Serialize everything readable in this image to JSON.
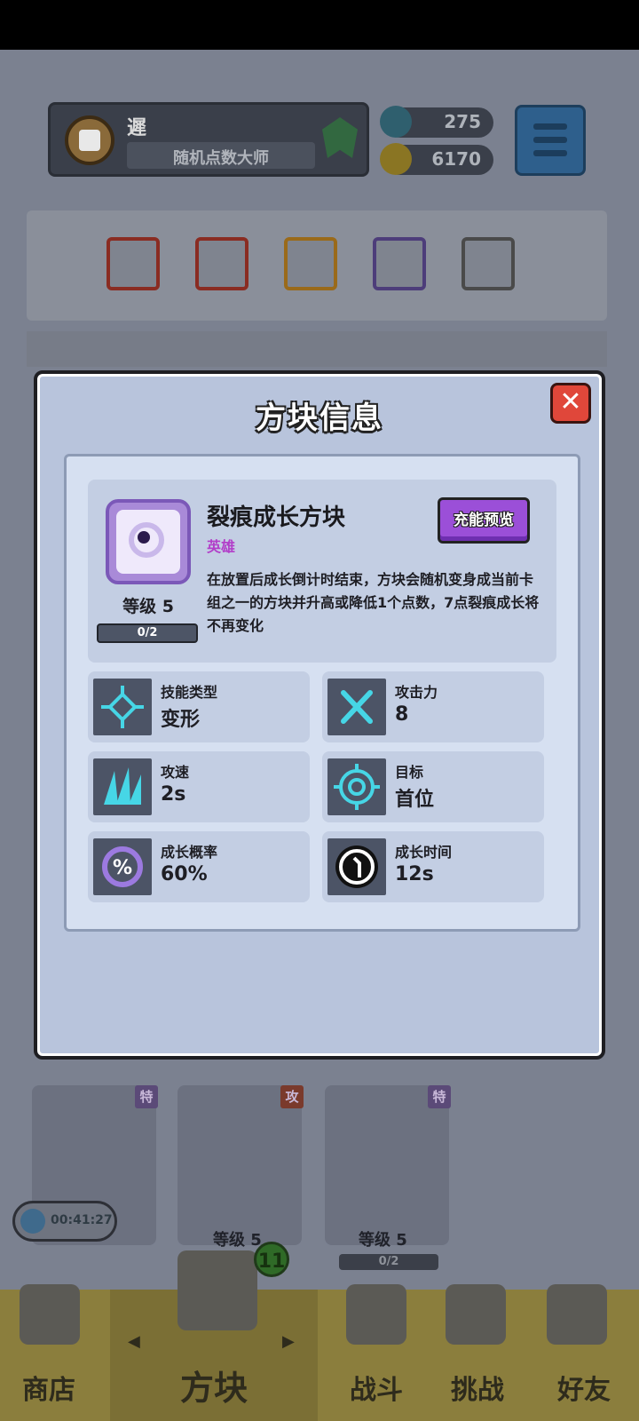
{
  "player": {
    "name": "遲",
    "title": "随机点数大师"
  },
  "resources": {
    "gems": "275",
    "coins": "6170"
  },
  "background": {
    "level_label": "等级 5",
    "progress": "0/2",
    "tag_special": "特",
    "tag_attack": "攻",
    "timer": "00:41:27",
    "box_badge": "11"
  },
  "nav": {
    "shop": "商店",
    "blocks": "方块",
    "battle": "战斗",
    "challenge": "挑战",
    "friends": "好友"
  },
  "dialog": {
    "title": "方块信息",
    "close_symbol": "✕",
    "block_name": "裂痕成长方块",
    "rarity": "英雄",
    "preview_button": "充能预览",
    "level": "等级 5",
    "progress": "0/2",
    "description": "在放置后成长倒计时结束，方块会随机变身成当前卡组之一的方块并升高或降低1个点数，7点裂痕成长将不再变化",
    "stats": [
      {
        "label": "技能类型",
        "value": "变形",
        "icon": "transform-icon"
      },
      {
        "label": "攻击力",
        "value": "8",
        "icon": "crossed-swords-icon"
      },
      {
        "label": "攻速",
        "value": "2s",
        "icon": "attack-speed-icon"
      },
      {
        "label": "目标",
        "value": "首位",
        "icon": "target-icon"
      },
      {
        "label": "成长概率",
        "value": "60%",
        "icon": "growth-chance-icon"
      },
      {
        "label": "成长时间",
        "value": "12s",
        "icon": "growth-time-icon"
      }
    ]
  },
  "colors": {
    "dialog_bg": "#b8c4dc",
    "rarity": "#b23ec9",
    "preview_button": "#9b4fd8",
    "close_button": "#e0473a",
    "stat_icon_accent": "#46d6e6"
  }
}
